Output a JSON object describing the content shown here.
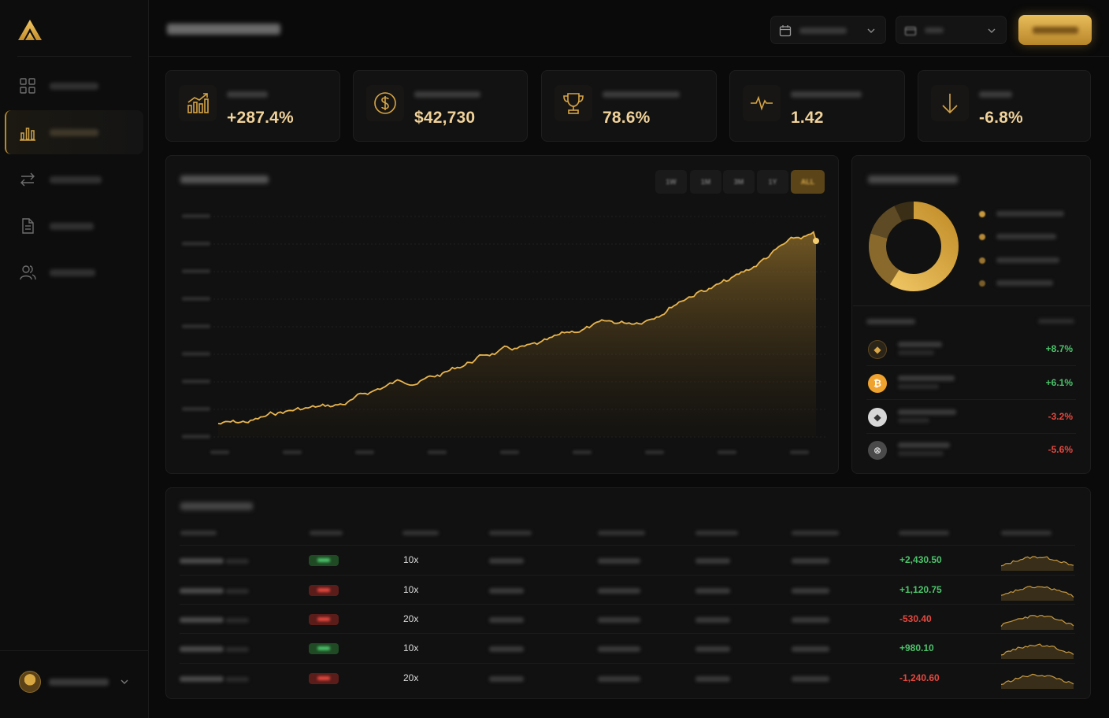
{
  "app": {
    "accent": "#d8a84a"
  },
  "sidebar": {
    "items": [
      {
        "icon": "grid-icon",
        "active": false
      },
      {
        "icon": "bar-chart-icon",
        "active": true
      },
      {
        "icon": "swap-arrows-icon",
        "active": false
      },
      {
        "icon": "document-icon",
        "active": false
      },
      {
        "icon": "users-icon",
        "active": false
      }
    ]
  },
  "stats": [
    {
      "icon": "growth-chart-icon",
      "value": "+287.4%"
    },
    {
      "icon": "dollar-coin-icon",
      "value": "$42,730"
    },
    {
      "icon": "trophy-icon",
      "value": "78.6%"
    },
    {
      "icon": "pulse-icon",
      "value": "1.42"
    },
    {
      "icon": "arrow-down-icon",
      "value": "-6.8%"
    }
  ],
  "performance": {
    "ranges": [
      "1W",
      "1M",
      "3M",
      "1Y",
      "ALL"
    ],
    "active_range": "ALL"
  },
  "assets": [
    {
      "icon": "ethereum-icon",
      "change": "+8.7%",
      "direction": "up"
    },
    {
      "icon": "bitcoin-icon",
      "change": "+6.1%",
      "direction": "up"
    },
    {
      "icon": "ethereum-silver-icon",
      "change": "-3.2%",
      "direction": "down"
    },
    {
      "icon": "coin-silver-icon",
      "change": "-5.6%",
      "direction": "down"
    }
  ],
  "positions": {
    "rows": [
      {
        "side": "long",
        "leverage": "10x",
        "pnl": "+2,430.50"
      },
      {
        "side": "short",
        "leverage": "10x",
        "pnl": "+1,120.75"
      },
      {
        "side": "short",
        "leverage": "20x",
        "pnl": "-530.40"
      },
      {
        "side": "long",
        "leverage": "10x",
        "pnl": "+980.10"
      },
      {
        "side": "short",
        "leverage": "20x",
        "pnl": "-1,240.60"
      }
    ]
  }
}
